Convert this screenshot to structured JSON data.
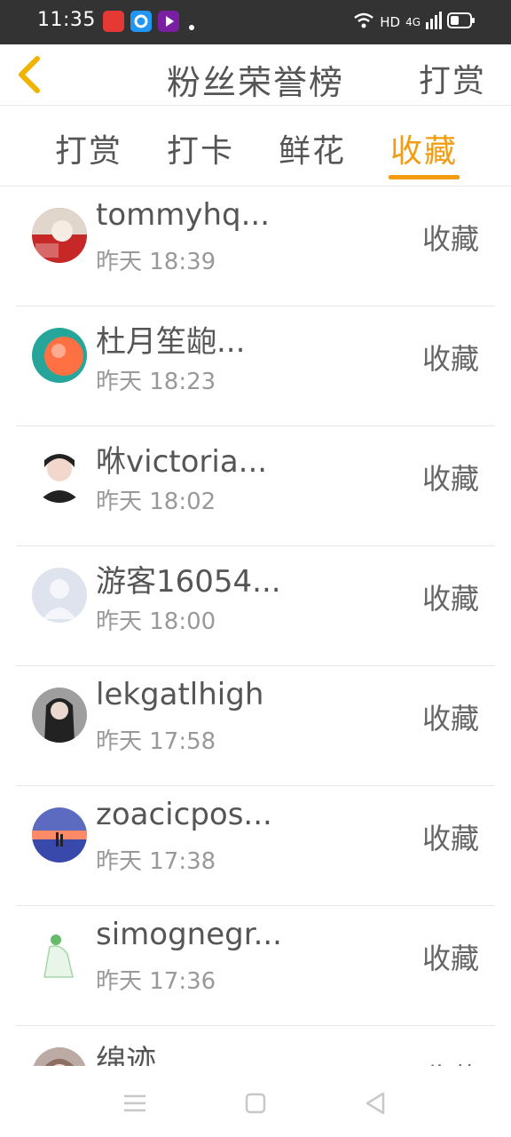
{
  "status_bar": {
    "time": "11:35",
    "hd_label": "HD",
    "network_label": "4G"
  },
  "header": {
    "title": "粉丝荣誉榜",
    "action_label": "打赏"
  },
  "tabs": [
    {
      "label": "打赏",
      "active": false
    },
    {
      "label": "打卡",
      "active": false
    },
    {
      "label": "鲜花",
      "active": false
    },
    {
      "label": "收藏",
      "active": true
    }
  ],
  "list": [
    {
      "name": "tommyhq...",
      "time": "昨天 18:39",
      "action": "收藏"
    },
    {
      "name": "杜月笙龅...",
      "time": "昨天 18:23",
      "action": "收藏"
    },
    {
      "name": "咻victoria...",
      "time": "昨天 18:02",
      "action": "收藏"
    },
    {
      "name": "游客16054...",
      "time": "昨天 18:00",
      "action": "收藏"
    },
    {
      "name": "lekgatlhigh",
      "time": "昨天 17:58",
      "action": "收藏"
    },
    {
      "name": "zoacicpos...",
      "time": "昨天 17:38",
      "action": "收藏"
    },
    {
      "name": "simognegr...",
      "time": "昨天 17:36",
      "action": "收藏"
    },
    {
      "name": "绵迹",
      "time": "",
      "action": "收藏"
    }
  ],
  "colors": {
    "accent": "#f39c12",
    "status_bar_bg": "#333333",
    "text_primary": "#555555",
    "text_secondary": "#999999"
  }
}
